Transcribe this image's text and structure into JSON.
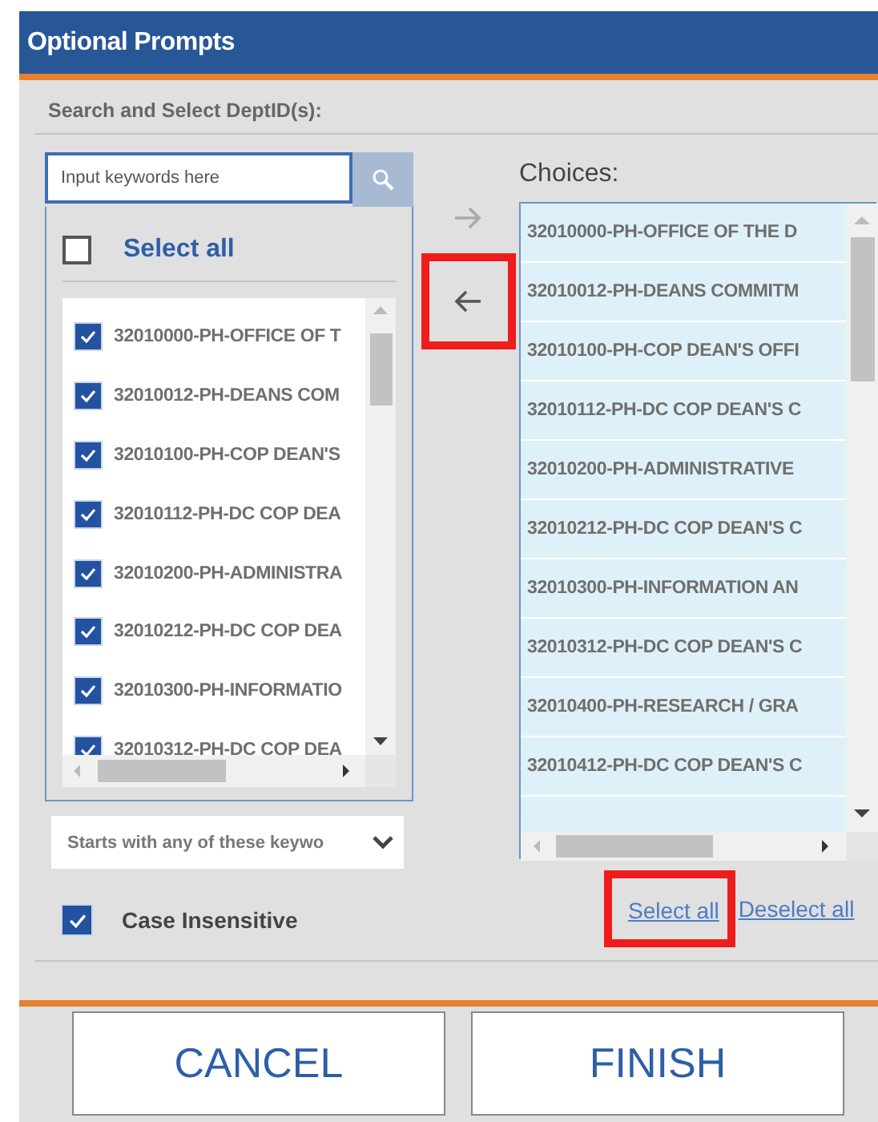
{
  "dialog": {
    "title": "Optional Prompts"
  },
  "section_label": "Search and Select DeptID(s):",
  "search": {
    "placeholder": "Input keywords here"
  },
  "available": {
    "select_all": {
      "label": "Select all",
      "checked": false
    },
    "items": [
      {
        "label": "32010000-PH-OFFICE OF T",
        "checked": true
      },
      {
        "label": "32010012-PH-DEANS COM",
        "checked": true
      },
      {
        "label": "32010100-PH-COP DEAN'S",
        "checked": true
      },
      {
        "label": "32010112-PH-DC COP DEA",
        "checked": true
      },
      {
        "label": "32010200-PH-ADMINISTRA",
        "checked": true
      },
      {
        "label": "32010212-PH-DC COP DEA",
        "checked": true
      },
      {
        "label": "32010300-PH-INFORMATIO",
        "checked": true
      },
      {
        "label": "32010312-PH-DC COP DEA",
        "checked": true
      }
    ]
  },
  "transfer": [
    {
      "kind": "add",
      "disabled": true,
      "highlighted": false
    },
    {
      "kind": "remove",
      "disabled": false,
      "highlighted": true
    }
  ],
  "choices": {
    "label": "Choices:",
    "items": [
      {
        "label": "32010000-PH-OFFICE OF THE D",
        "selected": true
      },
      {
        "label": "32010012-PH-DEANS COMMITM",
        "selected": true
      },
      {
        "label": "32010100-PH-COP DEAN'S OFFI",
        "selected": true
      },
      {
        "label": "32010112-PH-DC COP DEAN'S C",
        "selected": true
      },
      {
        "label": "32010200-PH-ADMINISTRATIVE",
        "selected": true
      },
      {
        "label": "32010212-PH-DC COP DEAN'S C",
        "selected": true
      },
      {
        "label": "32010300-PH-INFORMATION AN",
        "selected": true
      },
      {
        "label": "32010312-PH-DC COP DEAN'S C",
        "selected": true
      },
      {
        "label": "32010400-PH-RESEARCH / GRA",
        "selected": true
      },
      {
        "label": "32010412-PH-DC COP DEAN'S C",
        "selected": true
      }
    ]
  },
  "match_mode": {
    "value": "Starts with any of these keywo"
  },
  "case_insensitive": {
    "label": "Case Insensitive",
    "checked": true
  },
  "links": [
    {
      "label": "Select all",
      "highlighted": true
    },
    {
      "label": "Deselect all",
      "highlighted": false
    }
  ],
  "buttons": [
    "CANCEL",
    "FINISH"
  ]
}
